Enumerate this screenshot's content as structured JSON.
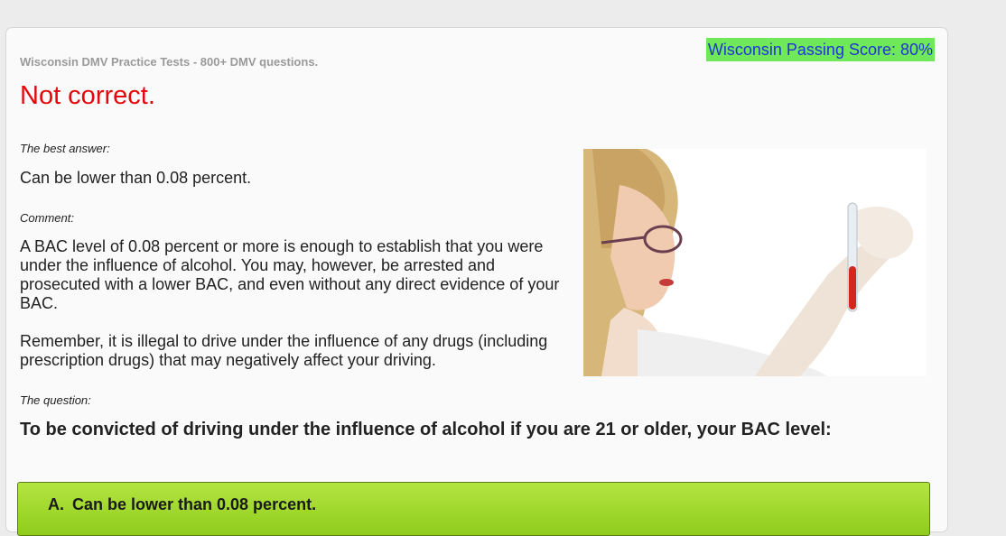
{
  "header": {
    "site_title": "Wisconsin DMV Practice Tests - 800+ DMV questions.",
    "passing_score": "Wisconsin Passing Score: 80%"
  },
  "result": {
    "title": "Not correct.",
    "best_answer_label": "The best answer:",
    "best_answer": "Can be lower than 0.08 percent.",
    "comment_label": "Comment:",
    "comment_paragraphs": [
      "A BAC level of 0.08 percent or more is enough to establish that you were under the influence of alcohol. You may, however, be arrested and prosecuted with a lower BAC, and even without any direct evidence of your BAC.",
      "Remember, it is illegal to drive under the influence of any drugs (including prescription drugs) that may negatively affect your driving."
    ]
  },
  "question": {
    "label": "The question:",
    "text": "To be convicted of driving under the influence of alcohol if you are 21 or older, your BAC level:",
    "options": [
      {
        "letter": "A.",
        "text": "Can be lower than 0.08 percent."
      }
    ]
  },
  "colors": {
    "incorrect": "#e4070b",
    "passing_score_bg": "#6fe85a",
    "passing_score_text": "#1f33d6",
    "correct_option": "#a3d92e"
  },
  "image": {
    "icon": "lab-technician-test-tube-photo"
  }
}
